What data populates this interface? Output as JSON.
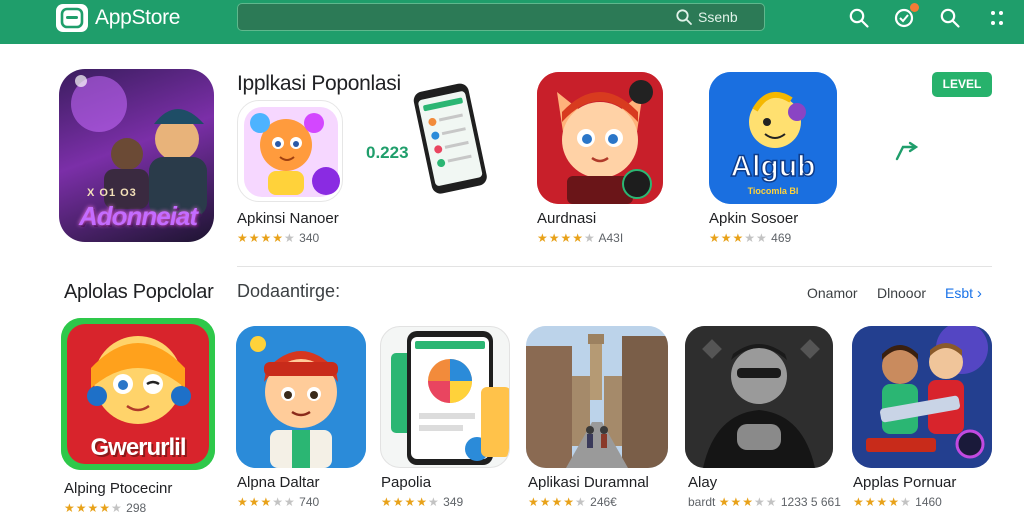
{
  "header": {
    "app_title": "AppStore",
    "search_text": "Ssenb",
    "icons": [
      "search-icon",
      "notifications-icon",
      "search-icon",
      "more-icon"
    ]
  },
  "featured": {
    "title": "Ipplkasi Poponlasi",
    "big_tile_caption": "Adonneiat",
    "big_tile_small_text": "X  O1  O3",
    "number": "0.223",
    "level_button": "LEVEL",
    "tile_a_badge": "☸",
    "tile_c_logo": "Algub",
    "tile_c_sub": "Tiocomla Bl",
    "apps": [
      {
        "name": "Apkinsi Nanoer",
        "stars": 4,
        "rating": "340"
      },
      {
        "name": "Aurdnasi",
        "stars": 4.5,
        "rating": "A43I"
      },
      {
        "name": "Apkin Sosoer",
        "stars": 3.5,
        "rating": "469"
      }
    ]
  },
  "popular": {
    "title": "Aplolas Popclolar",
    "subtitle": "Dodaantirge:",
    "links": [
      "Onamor",
      "Dlnooor",
      "Esbt"
    ],
    "apps": [
      {
        "name": "Alping Ptocecinr",
        "stars": 4,
        "rating": "298",
        "tile_text": "Gwerurlil"
      },
      {
        "name": "Alpna Daltar",
        "stars": 3.5,
        "rating": "740"
      },
      {
        "name": "Papolia",
        "stars": 4,
        "rating": "349"
      },
      {
        "name": "Aplikasi Duramnal",
        "stars": 4,
        "rating": "246€"
      },
      {
        "name": "Alay",
        "stars": 3.5,
        "rating": "1233 5 661",
        "prefix": "bardt"
      },
      {
        "name": "Applas Pornuar",
        "stars": 4,
        "rating": "1460"
      }
    ]
  },
  "colors": {
    "header_green": "#1f9e6b",
    "accent_blue": "#1a73e8",
    "star_gold": "#e8a21a",
    "level_green": "#27b26c"
  }
}
